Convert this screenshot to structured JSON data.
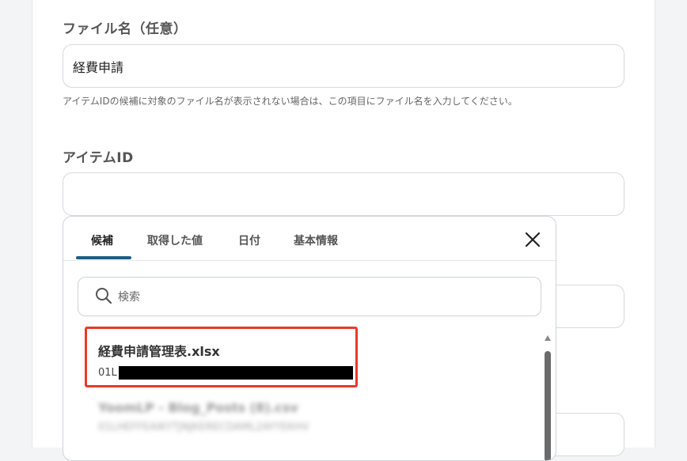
{
  "form": {
    "filename_label": "ファイル名（任意）",
    "filename_value": "経費申請",
    "filename_help": "アイテムIDの候補に対象のファイル名が表示されない場合は、この項目にファイル名を入力してください。",
    "itemid_label": "アイテムID",
    "itemid_value": ""
  },
  "popup": {
    "tabs": [
      {
        "label": "候補",
        "active": true
      },
      {
        "label": "取得した値",
        "active": false
      },
      {
        "label": "日付",
        "active": false
      },
      {
        "label": "基本情報",
        "active": false
      }
    ],
    "search": {
      "placeholder": "検索"
    },
    "results": [
      {
        "title": "経費申請管理表.xlsx",
        "id_prefix": "01L",
        "highlighted": true
      },
      {
        "title": "YoomLP - Blog_Posts (8).csv",
        "id_text": "01LHEFFEAIKYTJNJKERECDAML2AYYEKHV",
        "blurred": true
      }
    ]
  },
  "colors": {
    "accent": "#1b5f85",
    "highlight_border": "#e8392b"
  }
}
